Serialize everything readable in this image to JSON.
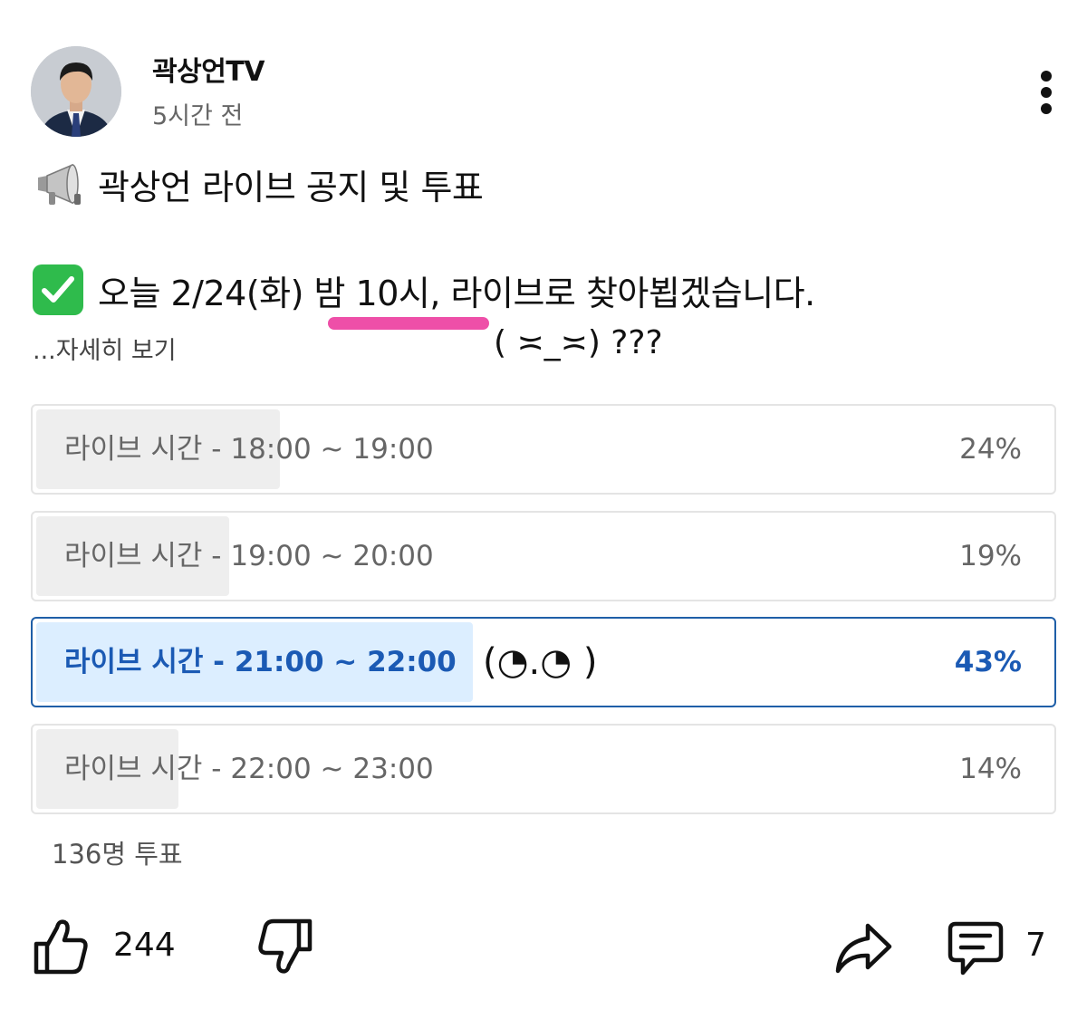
{
  "post": {
    "channel_name": "곽상언TV",
    "timestamp": "5시간 전",
    "headline_icon": "megaphone-icon",
    "headline": "곽상언 라이브 공지 및 투표",
    "announce_icon": "check-mark-button-icon",
    "announcement": "오늘 2/24(화) 밤 10시, 라이브로 찾아뵙겠습니다.",
    "more_label": "...자세히 보기",
    "annotation_face": "( ≍_≍) ???"
  },
  "poll": {
    "options": [
      {
        "label": "라이브 시간 - 18:00 ~ 19:00",
        "percent_text": "24%",
        "percent": 24,
        "selected": false
      },
      {
        "label": "라이브 시간 - 19:00 ~ 20:00",
        "percent_text": "19%",
        "percent": 19,
        "selected": false
      },
      {
        "label": "라이브 시간 - 21:00 ~ 22:00",
        "percent_text": "43%",
        "percent": 43,
        "selected": true
      },
      {
        "label": "라이브 시간 - 22:00 ~ 23:00",
        "percent_text": "14%",
        "percent": 14,
        "selected": false
      }
    ],
    "selected_annotation": "(◔.◔ )",
    "total_votes": "136명 투표"
  },
  "actions": {
    "like_count": "244",
    "comment_count": "7"
  },
  "colors": {
    "accent_blue": "#1b5ab4",
    "selected_fill": "#dceeff",
    "highlight_underline": "#ee4fa8",
    "check_green": "#2fbb4c"
  }
}
